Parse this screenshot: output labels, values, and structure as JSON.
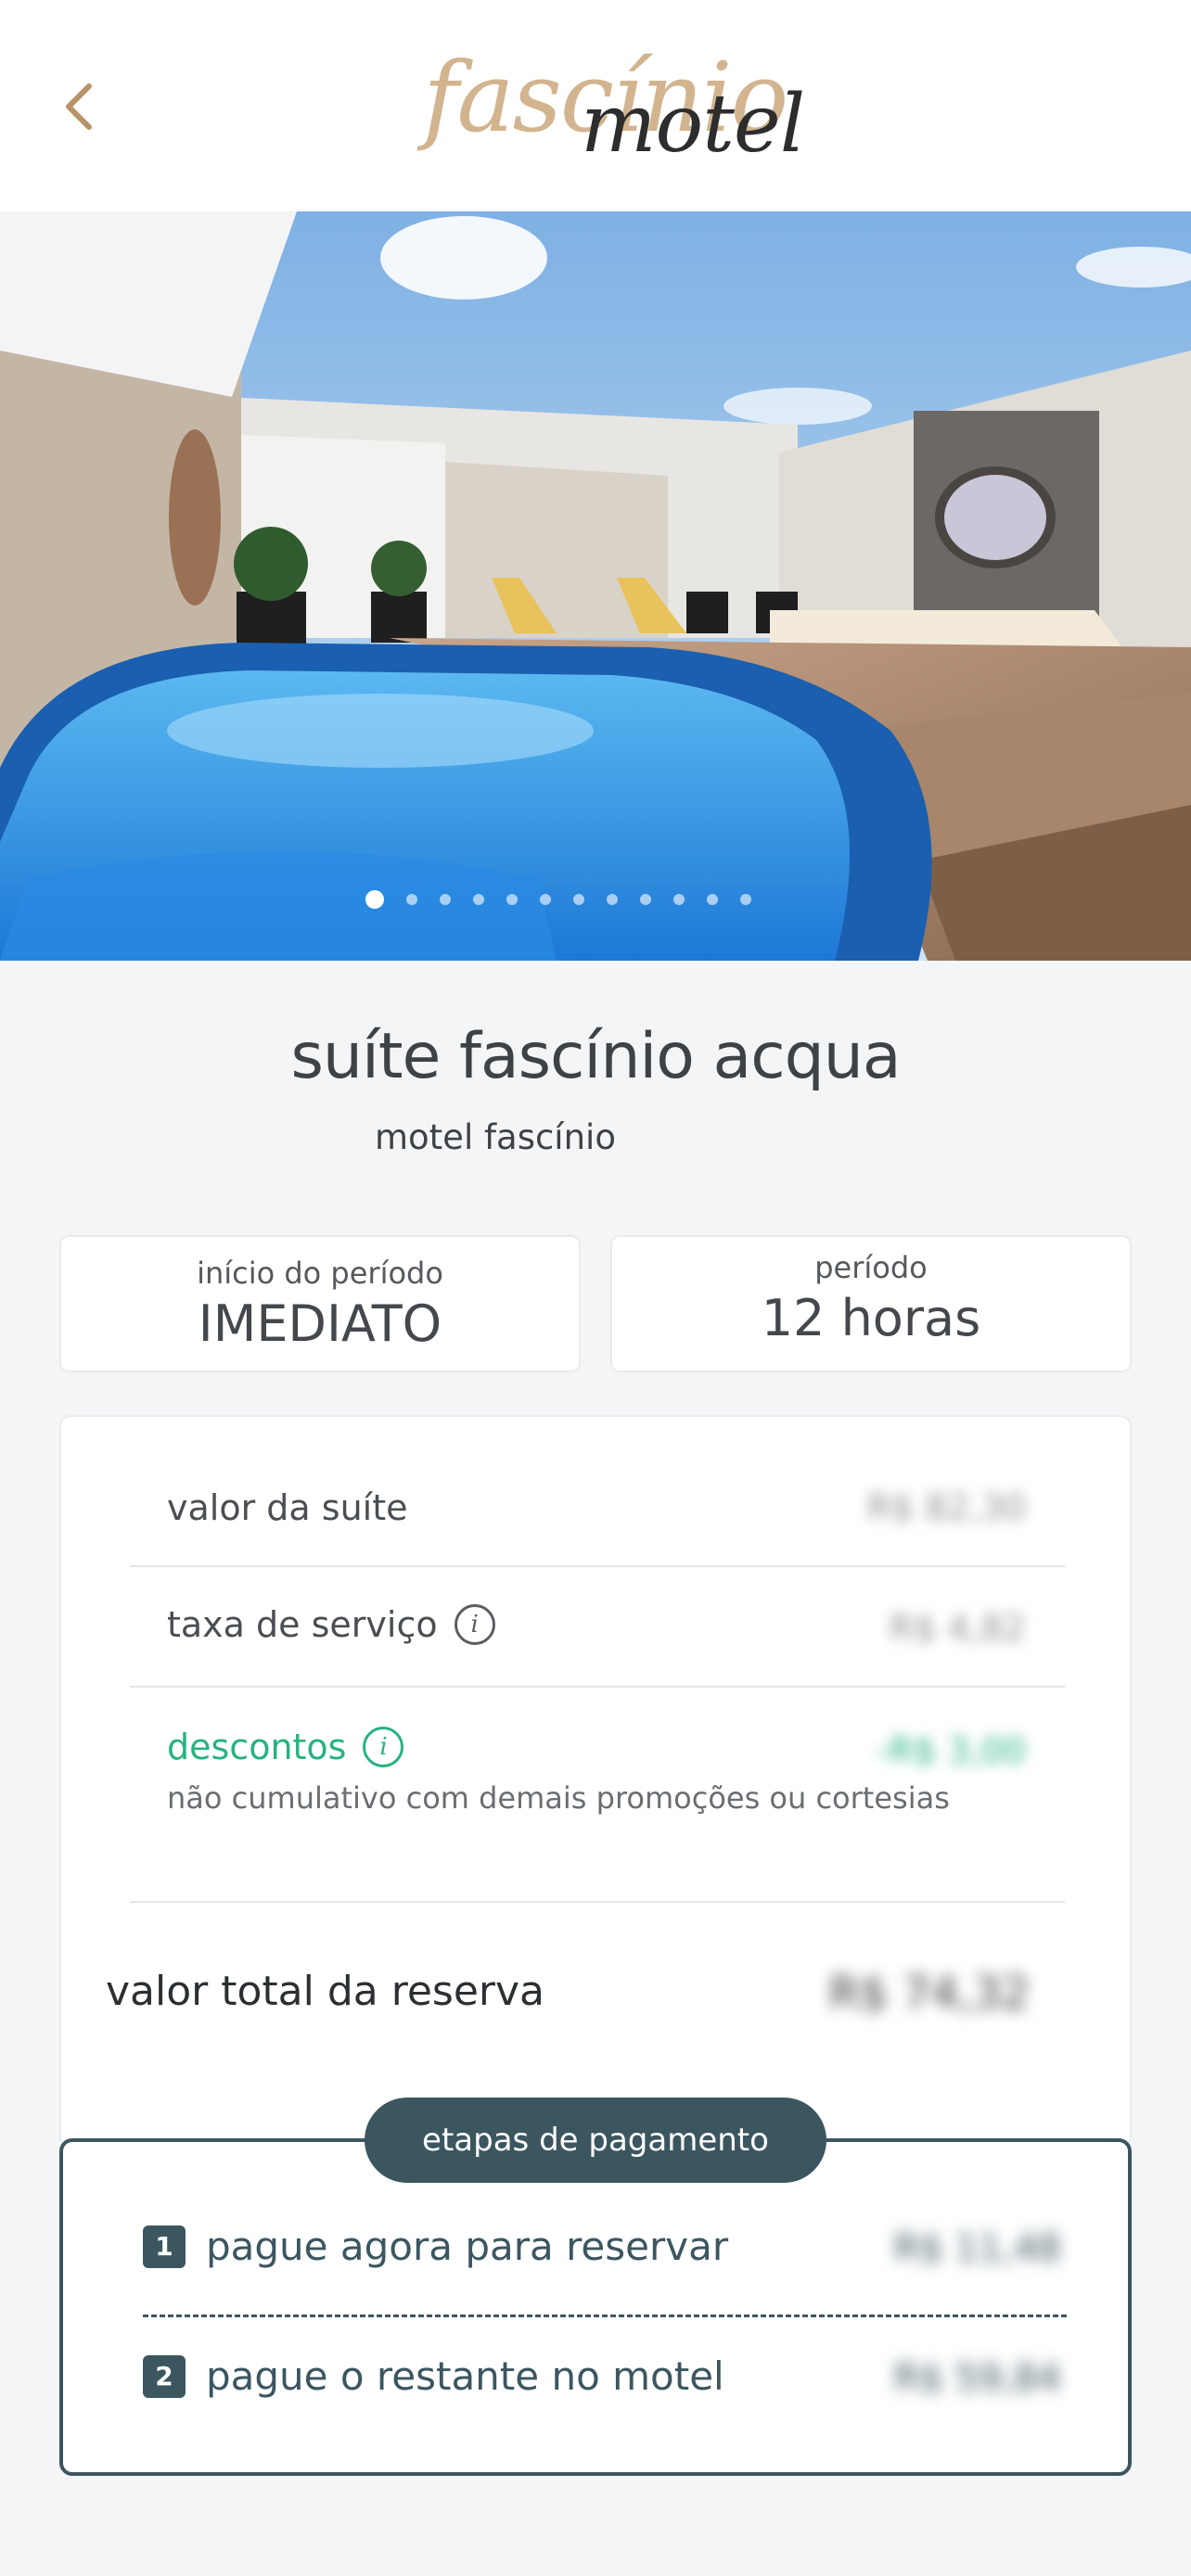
{
  "header": {
    "logo_script": "fascínio",
    "logo_sub": "motel"
  },
  "hero": {
    "image_alt": "",
    "slide_count": 12,
    "active_slide": 1
  },
  "suite": {
    "title": "suíte fascínio acqua",
    "motel": "motel fascínio"
  },
  "period": {
    "start_label": "início do período",
    "start_value": "IMEDIATO",
    "duration_label": "período",
    "duration_value": "12 horas"
  },
  "pricing": {
    "suite_label": "valor da suíte",
    "suite_amount": "R$ 82,30",
    "service_label": "taxa de serviço",
    "service_amount": "R$ 4,82",
    "discount_label": "descontos",
    "discount_amount": "-R$ 3,00",
    "discount_note": "não cumulativo com demais promoções ou cortesias",
    "total_label": "valor total da reserva",
    "total_amount": "R$ 74,32"
  },
  "payment_steps": {
    "title": "etapas de pagamento",
    "steps": [
      {
        "num": "1",
        "label": "pague agora para reservar",
        "amount": "R$ 11,48"
      },
      {
        "num": "2",
        "label": "pague o restante no motel",
        "amount": "R$ 59,84"
      }
    ]
  },
  "colors": {
    "accent_gold": "#d2b48f",
    "dark_teal": "#3c5660",
    "discount_green": "#27b37e"
  }
}
